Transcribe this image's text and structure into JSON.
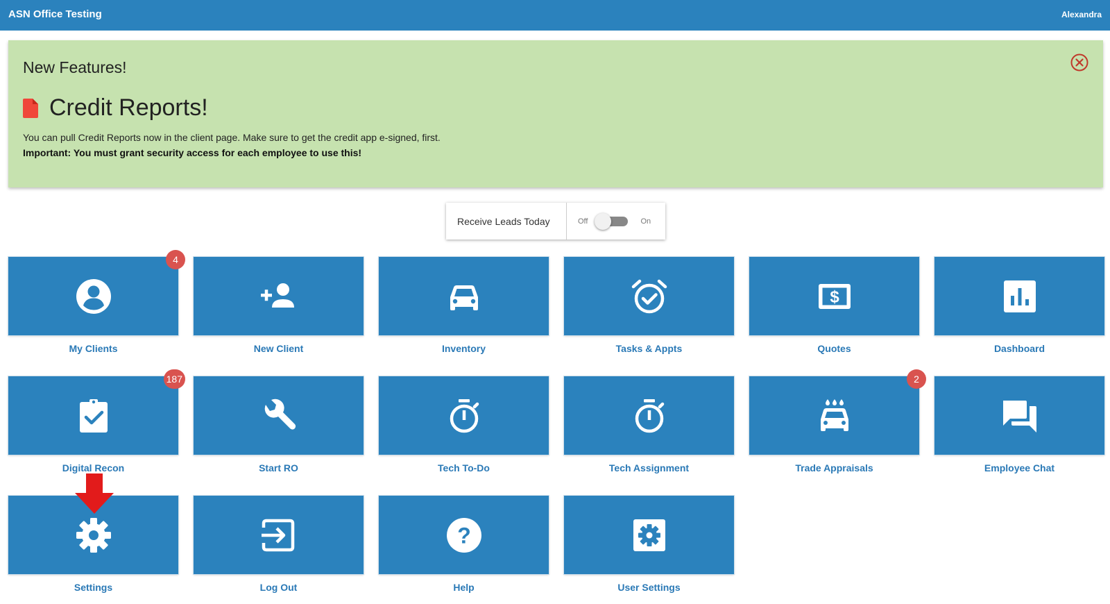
{
  "header": {
    "title": "ASN Office Testing",
    "user": "Alexandra"
  },
  "banner": {
    "heading": "New Features!",
    "feature_title": "Credit Reports!",
    "message": "You can pull Credit Reports now in the client page. Make sure to get the credit app e-signed, first.",
    "important": "Important: You must grant security access for each employee to use this!"
  },
  "leads": {
    "label": "Receive Leads Today",
    "off": "Off",
    "on": "On",
    "enabled": false
  },
  "tiles": [
    {
      "label": "My Clients",
      "icon": "account-circle-icon",
      "badge": "4"
    },
    {
      "label": "New Client",
      "icon": "person-add-icon"
    },
    {
      "label": "Inventory",
      "icon": "car-icon"
    },
    {
      "label": "Tasks & Appts",
      "icon": "alarm-check-icon"
    },
    {
      "label": "Quotes",
      "icon": "dollar-icon"
    },
    {
      "label": "Dashboard",
      "icon": "bar-chart-icon"
    },
    {
      "label": "Digital Recon",
      "icon": "clipboard-check-icon",
      "badge": "187"
    },
    {
      "label": "Start RO",
      "icon": "wrench-icon"
    },
    {
      "label": "Tech To-Do",
      "icon": "stopwatch-icon"
    },
    {
      "label": "Tech Assignment",
      "icon": "stopwatch-icon"
    },
    {
      "label": "Trade Appraisals",
      "icon": "car-wash-icon",
      "badge": "2"
    },
    {
      "label": "Employee Chat",
      "icon": "chat-icon"
    },
    {
      "label": "Settings",
      "icon": "gear-icon"
    },
    {
      "label": "Log Out",
      "icon": "logout-icon"
    },
    {
      "label": "Help",
      "icon": "help-icon"
    },
    {
      "label": "User Settings",
      "icon": "settings-box-icon"
    }
  ],
  "colors": {
    "primary": "#2b82bd",
    "banner_bg": "#c6e2af",
    "badge": "#d9534f",
    "arrow": "#e21b1b"
  }
}
